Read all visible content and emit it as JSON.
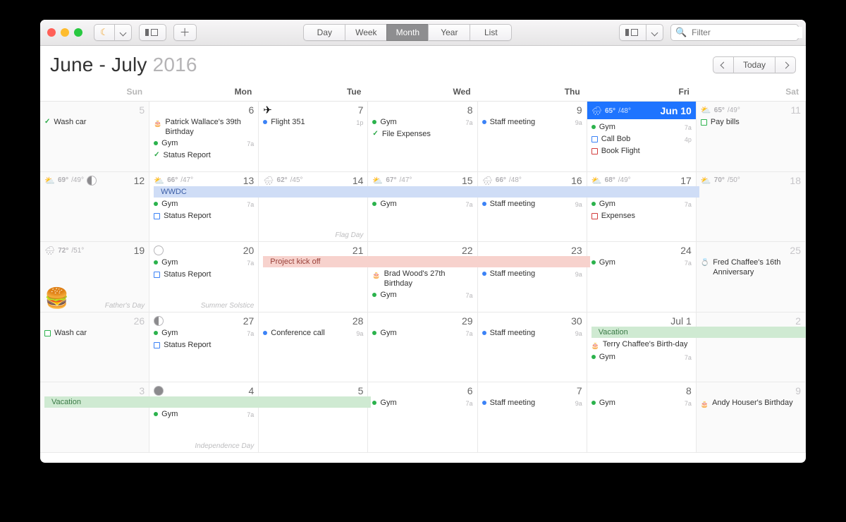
{
  "toolbar": {
    "views": [
      "Day",
      "Week",
      "Month",
      "Year",
      "List"
    ],
    "active_view": "Month",
    "search_placeholder": "Filter"
  },
  "header": {
    "title_months": "June - July",
    "title_year": "2016",
    "today_label": "Today"
  },
  "dow": [
    "Sun",
    "Mon",
    "Tue",
    "Wed",
    "Thu",
    "Fri",
    "Sat"
  ],
  "banners": {
    "wwdc": "WWDC",
    "project": "Project kick off",
    "vacation": "Vacation"
  },
  "weeks": [
    [
      {
        "date": "5",
        "dim": true,
        "we": true,
        "weather": null,
        "events": [
          {
            "kind": "check",
            "label": "Wash car"
          }
        ]
      },
      {
        "date": "6",
        "weather": null,
        "events": [
          {
            "kind": "cake",
            "label": "Patrick Wallace's 39th Birthday"
          },
          {
            "kind": "dot",
            "color": "green",
            "label": "Gym",
            "time": "7a"
          },
          {
            "kind": "check",
            "label": "Status Report"
          }
        ]
      },
      {
        "date": "7",
        "dateIcon": "plane",
        "weather": null,
        "events": [
          {
            "kind": "dot",
            "color": "blue",
            "label": "Flight 351",
            "time": "1p"
          }
        ]
      },
      {
        "date": "8",
        "weather": null,
        "events": [
          {
            "kind": "dot",
            "color": "green",
            "label": "Gym",
            "time": "7a"
          },
          {
            "kind": "check",
            "label": "File Expenses"
          }
        ]
      },
      {
        "date": "9",
        "weather": null,
        "events": [
          {
            "kind": "dot",
            "color": "blue",
            "label": "Staff meeting",
            "time": "9a"
          }
        ]
      },
      {
        "date": "Jun 10",
        "today": true,
        "weather": {
          "icon": "🌧",
          "hi": "65°",
          "lo": "/48°"
        },
        "events": [
          {
            "kind": "dot",
            "color": "green",
            "label": "Gym",
            "time": "7a"
          },
          {
            "kind": "sq",
            "color": "blue",
            "label": "Call Bob",
            "time": "4p"
          },
          {
            "kind": "sq",
            "color": "red",
            "label": "Book Flight"
          }
        ]
      },
      {
        "date": "11",
        "dim": true,
        "we": true,
        "weather": {
          "icon": "⛅",
          "hi": "65°",
          "lo": "/49°"
        },
        "events": [
          {
            "kind": "sq",
            "color": "green",
            "label": "Pay bills"
          }
        ]
      }
    ],
    [
      {
        "date": "12",
        "we": true,
        "weather": {
          "icon": "⛅",
          "hi": "69°",
          "lo": "/49°"
        },
        "moon": "half",
        "events": []
      },
      {
        "date": "13",
        "weather": {
          "icon": "⛅",
          "hi": "66°",
          "lo": "/47°"
        },
        "events": [
          {
            "kind": "dot",
            "color": "green",
            "label": "Gym",
            "time": "7a"
          },
          {
            "kind": "sq",
            "color": "blue",
            "label": "Status Report"
          }
        ]
      },
      {
        "date": "14",
        "weather": {
          "icon": "🌧",
          "hi": "62°",
          "lo": "/45°"
        },
        "special": "Flag Day",
        "events": []
      },
      {
        "date": "15",
        "weather": {
          "icon": "⛅",
          "hi": "67°",
          "lo": "/47°"
        },
        "events": [
          {
            "kind": "dot",
            "color": "green",
            "label": "Gym",
            "time": "7a"
          }
        ]
      },
      {
        "date": "16",
        "weather": {
          "icon": "🌧",
          "hi": "66°",
          "lo": "/48°"
        },
        "events": [
          {
            "kind": "dot",
            "color": "blue",
            "label": "Staff meeting",
            "time": "9a"
          }
        ]
      },
      {
        "date": "17",
        "weather": {
          "icon": "⛅",
          "hi": "68°",
          "lo": "/49°"
        },
        "events": [
          {
            "kind": "dot",
            "color": "green",
            "label": "Gym",
            "time": "7a"
          },
          {
            "kind": "sq",
            "color": "red",
            "label": "Expenses"
          }
        ]
      },
      {
        "date": "18",
        "dim": true,
        "we": true,
        "weather": {
          "icon": "⛅",
          "hi": "70°",
          "lo": "/50°"
        },
        "events": []
      }
    ],
    [
      {
        "date": "19",
        "we": true,
        "weather": {
          "icon": "🌧",
          "hi": "72°",
          "lo": "/51°"
        },
        "special": "Father's Day",
        "burger": true,
        "events": []
      },
      {
        "date": "20",
        "moon": "new",
        "special": "Summer Solstice",
        "events": [
          {
            "kind": "dot",
            "color": "green",
            "label": "Gym",
            "time": "7a"
          },
          {
            "kind": "sq",
            "color": "blue",
            "label": "Status Report"
          }
        ]
      },
      {
        "date": "21",
        "events": []
      },
      {
        "date": "22",
        "events": [
          {
            "kind": "cake",
            "label": "Brad Wood's 27th Birthday"
          },
          {
            "kind": "dot",
            "color": "green",
            "label": "Gym",
            "time": "7a"
          }
        ]
      },
      {
        "date": "23",
        "events": [
          {
            "kind": "dot",
            "color": "blue",
            "label": "Staff meeting",
            "time": "9a"
          }
        ]
      },
      {
        "date": "24",
        "events": [
          {
            "kind": "dot",
            "color": "green",
            "label": "Gym",
            "time": "7a"
          }
        ]
      },
      {
        "date": "25",
        "dim": true,
        "we": true,
        "events": [
          {
            "kind": "ring",
            "label": "Fred Chaffee's 16th Anniversary"
          }
        ]
      }
    ],
    [
      {
        "date": "26",
        "dim": true,
        "we": true,
        "events": [
          {
            "kind": "sq",
            "color": "green",
            "label": "Wash car"
          }
        ]
      },
      {
        "date": "27",
        "moon": "half",
        "events": [
          {
            "kind": "dot",
            "color": "green",
            "label": "Gym",
            "time": "7a"
          },
          {
            "kind": "sq",
            "color": "blue",
            "label": "Status Report"
          }
        ]
      },
      {
        "date": "28",
        "events": [
          {
            "kind": "dot",
            "color": "blue",
            "label": "Conference call",
            "time": "9a"
          }
        ]
      },
      {
        "date": "29",
        "events": [
          {
            "kind": "dot",
            "color": "green",
            "label": "Gym",
            "time": "7a"
          }
        ]
      },
      {
        "date": "30",
        "events": [
          {
            "kind": "dot",
            "color": "blue",
            "label": "Staff meeting",
            "time": "9a"
          }
        ]
      },
      {
        "date": "Jul 1",
        "events": [
          {
            "kind": "cake",
            "label": "Terry Chaffee's Birth-day"
          },
          {
            "kind": "dot",
            "color": "green",
            "label": "Gym",
            "time": "7a"
          }
        ]
      },
      {
        "date": "2",
        "dim": true,
        "we": true,
        "events": []
      }
    ],
    [
      {
        "date": "3",
        "dim": true,
        "we": true,
        "events": []
      },
      {
        "date": "4",
        "moon": "full",
        "special": "Independence Day",
        "events": [
          {
            "kind": "dot",
            "color": "green",
            "label": "Gym",
            "time": "7a"
          }
        ]
      },
      {
        "date": "5",
        "events": []
      },
      {
        "date": "6",
        "events": [
          {
            "kind": "dot",
            "color": "green",
            "label": "Gym",
            "time": "7a"
          }
        ]
      },
      {
        "date": "7",
        "events": [
          {
            "kind": "dot",
            "color": "blue",
            "label": "Staff meeting",
            "time": "9a"
          }
        ]
      },
      {
        "date": "8",
        "events": [
          {
            "kind": "dot",
            "color": "green",
            "label": "Gym",
            "time": "7a"
          }
        ]
      },
      {
        "date": "9",
        "dim": true,
        "we": true,
        "events": [
          {
            "kind": "cake",
            "label": "Andy Houser's Birthday"
          }
        ]
      }
    ]
  ]
}
